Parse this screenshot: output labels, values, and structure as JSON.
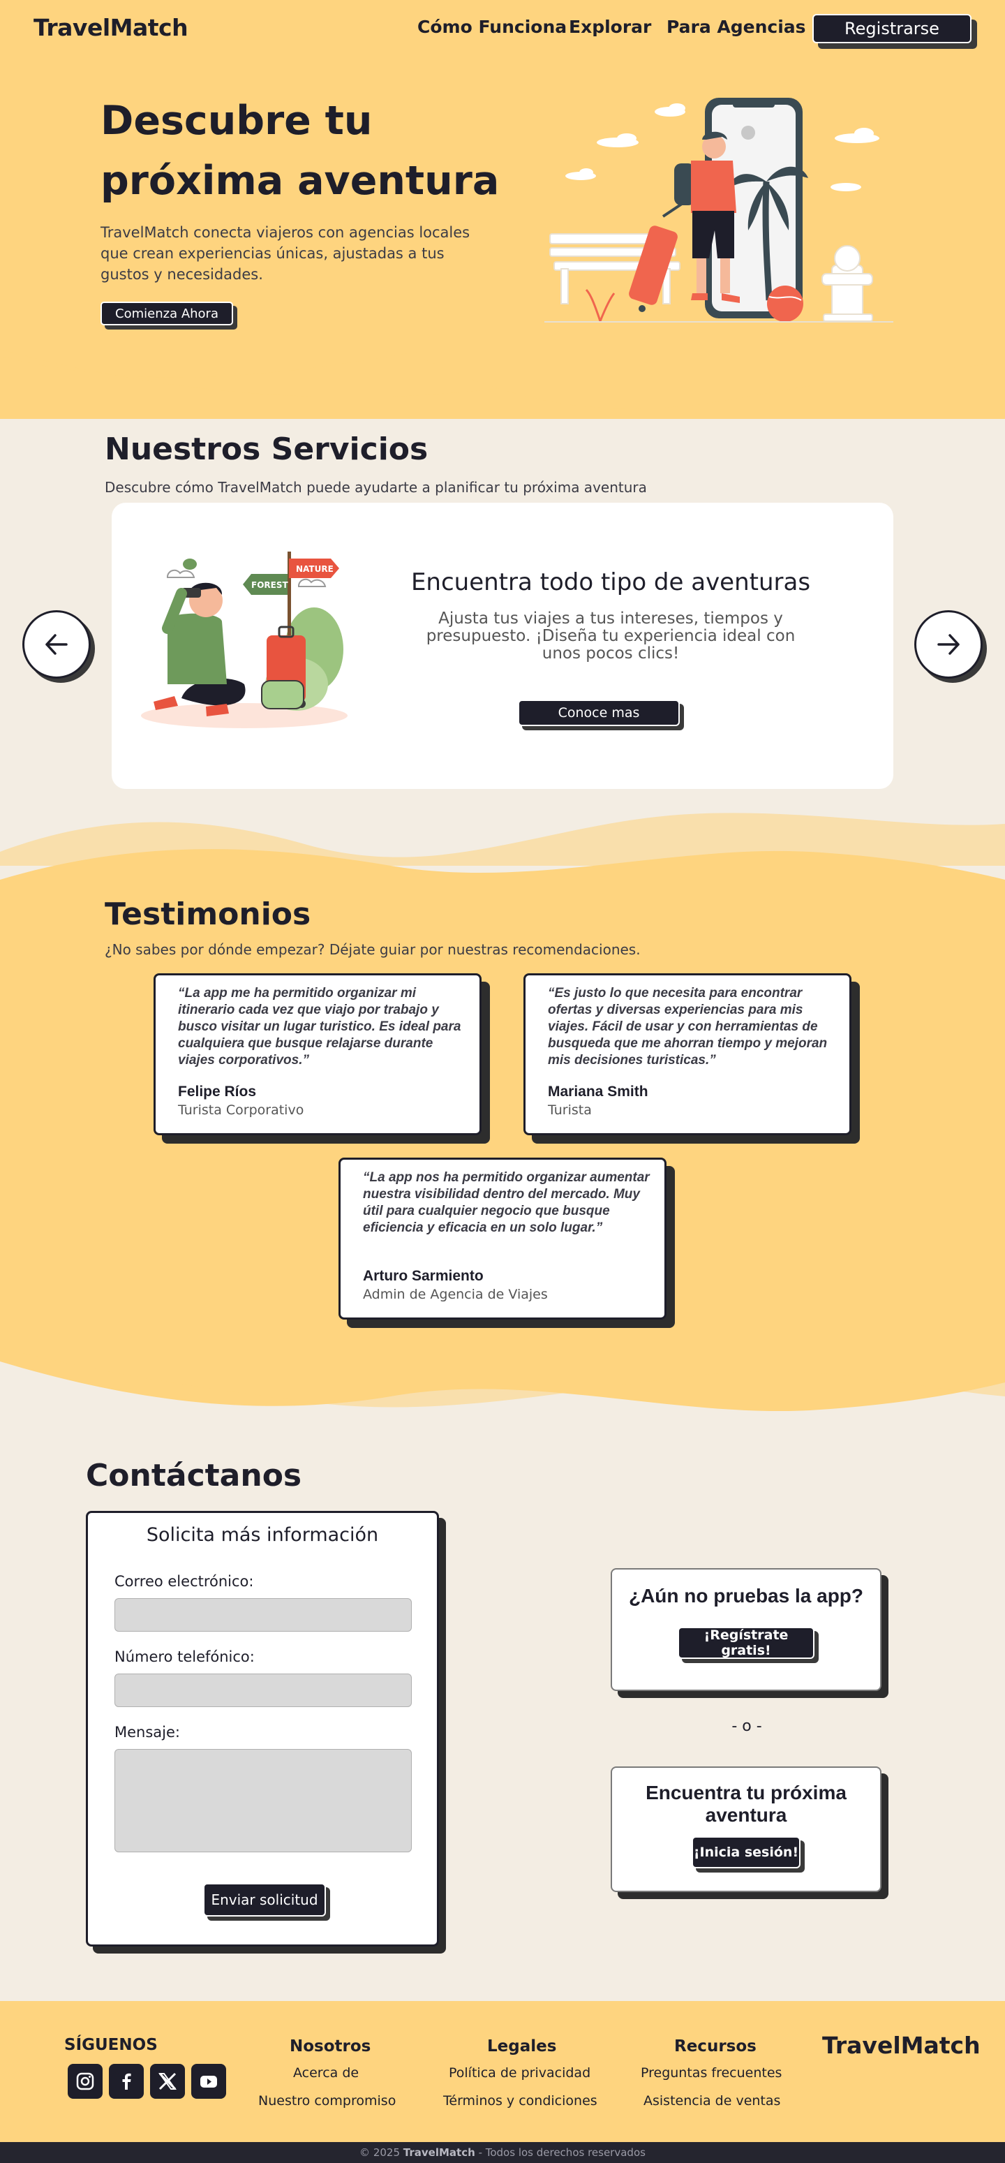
{
  "nav": {
    "logo": "TravelMatch",
    "links": [
      "Cómo Funciona",
      "Explorar",
      "Para Agencias"
    ],
    "register": "Registrarse"
  },
  "hero": {
    "title_line1": "Descubre tu",
    "title_line2": "próxima aventura",
    "description": "TravelMatch conecta viajeros con agencias locales que crean experiencias únicas, ajustadas a tus gustos y necesidades.",
    "cta": "Comienza Ahora"
  },
  "services": {
    "title": "Nuestros Servicios",
    "subtitle": "Descubre cómo TravelMatch puede ayudarte a planificar tu próxima aventura",
    "card": {
      "title": "Encuentra todo tipo de aventuras",
      "description": "Ajusta tus viajes a tus intereses, tiempos y presupuesto. ¡Diseña tu experiencia ideal con unos pocos clics!",
      "button": "Conoce mas",
      "sign_forest": "FOREST",
      "sign_nature": "NATURE"
    }
  },
  "testimonials": {
    "title": "Testimonios",
    "subtitle": "¿No sabes por dónde empezar? Déjate guiar por nuestras recomendaciones.",
    "items": [
      {
        "quote": "“La app me ha permitido organizar mi itinerario cada vez que viajo por trabajo y busco visitar  un lugar turistico. Es ideal para cualquiera que busque relajarse durante viajes corporativos.”",
        "name": "Felipe Ríos",
        "role": "Turista Corporativo"
      },
      {
        "quote": "“Es justo lo que necesita para encontrar ofertas y diversas experiencias para mis viajes. Fácil de usar y con herramientas de busqueda que me ahorran tiempo y mejoran mis decisiones turisticas.”",
        "name": "Mariana Smith",
        "role": "Turista"
      },
      {
        "quote": "“La app nos ha permitido organizar aumentar nuestra visibilidad dentro del mercado. Muy útil para cualquier negocio que busque eficiencia y eficacia en un solo lugar.”",
        "name": "Arturo Sarmiento",
        "role": "Admin de Agencia de Viajes"
      }
    ]
  },
  "contact": {
    "title": "Contáctanos",
    "form_title": "Solicita más información",
    "email_label": "Correo electrónico:",
    "phone_label": "Número telefónico:",
    "message_label": "Mensaje:",
    "submit": "Enviar solicitud",
    "cta1_title": "¿Aún no pruebas la app?",
    "cta1_button": "¡Regístrate gratis!",
    "separator": "- o -",
    "cta2_title": "Encuentra tu próxima aventura",
    "cta2_button": "¡Inicia sesión!"
  },
  "footer": {
    "follow": "SÍGUENOS",
    "col1_title": "Nosotros",
    "col1_links": [
      "Acerca de",
      "Nuestro compromiso"
    ],
    "col2_title": "Legales",
    "col2_links": [
      "Política de privacidad",
      "Términos y condiciones"
    ],
    "col3_title": "Recursos",
    "col3_links": [
      "Preguntas frecuentes",
      "Asistencia de ventas"
    ],
    "logo": "TravelMatch",
    "copy_prefix": "© 2025",
    "copy_brand": "TravelMatch",
    "copy_suffix": "- Todos los derechos reservados",
    "social_icons": [
      "instagram-icon",
      "facebook-icon",
      "x-icon",
      "youtube-icon"
    ]
  },
  "colors": {
    "accent": "#fed47f",
    "dark": "#1e1e2a",
    "background": "#f3ede3"
  }
}
